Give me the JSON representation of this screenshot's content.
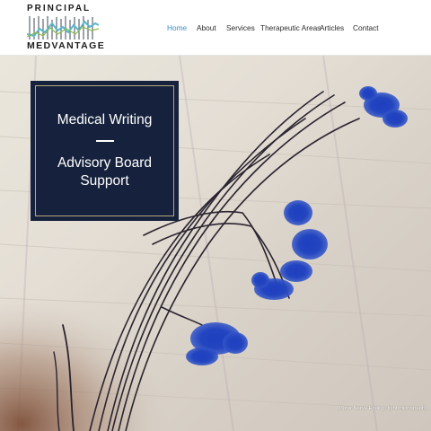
{
  "brand": {
    "name_top": "PRINCIPAL",
    "name_bottom": "MEDVANTAGE",
    "logo_colors": {
      "lines": "#3f4a57",
      "wave": "#5ab5cc",
      "accent": "#8bbd4a"
    }
  },
  "nav": {
    "items": [
      {
        "label": "Home",
        "active": true
      },
      {
        "label": "About"
      },
      {
        "label": "Services"
      },
      {
        "label": "Therapeutic Areas"
      },
      {
        "label": "Articles"
      },
      {
        "label": "Contact"
      }
    ],
    "active_color": "#3a8ec6"
  },
  "hero": {
    "promo": {
      "line1": "Medical Writing",
      "line2": "Advisory Board",
      "line3": "Support",
      "background": "#16223d",
      "border": "#b8a878"
    },
    "caption": "(Motor Nerve Ending, light micrograph)"
  }
}
